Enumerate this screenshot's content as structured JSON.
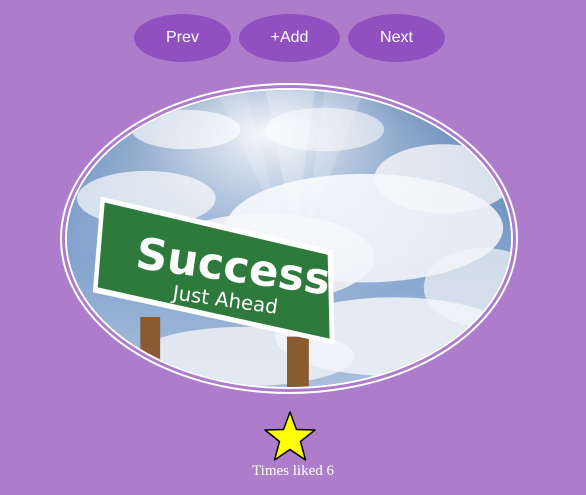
{
  "nav": {
    "prev_label": "Prev",
    "add_label": "+Add",
    "next_label": "Next"
  },
  "image": {
    "sign_line1": "Success",
    "sign_line2": "Just Ahead"
  },
  "likes": {
    "label": "Times liked 6",
    "icon": "star-icon"
  },
  "colors": {
    "background": "#ad7dcb",
    "button": "#9150bf",
    "star": "#ffff00",
    "sign": "#2e7a3c"
  }
}
